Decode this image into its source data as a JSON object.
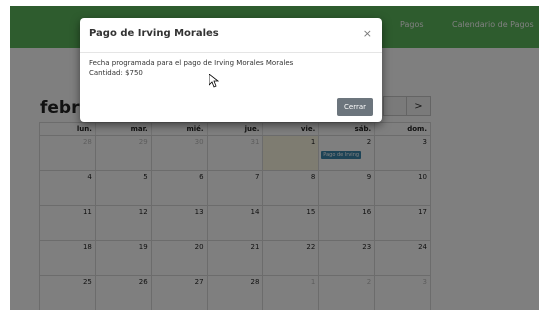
{
  "navbar": {
    "links": [
      "Pagos",
      "Calendario de Pagos"
    ]
  },
  "calendar": {
    "month_label": "febrero 2019",
    "prev_icon": "chevron-left-icon",
    "next_icon": "chevron-right-icon",
    "next_symbol": ">",
    "weekdays": [
      "lun.",
      "mar.",
      "mié.",
      "jue.",
      "vie.",
      "sáb.",
      "dom."
    ],
    "weeks": [
      [
        {
          "n": "28",
          "other": true
        },
        {
          "n": "29",
          "other": true
        },
        {
          "n": "30",
          "other": true
        },
        {
          "n": "31",
          "other": true
        },
        {
          "n": "1",
          "today": true
        },
        {
          "n": "2",
          "event": "Pago de Irving"
        },
        {
          "n": "3"
        }
      ],
      [
        {
          "n": "4"
        },
        {
          "n": "5"
        },
        {
          "n": "6"
        },
        {
          "n": "7"
        },
        {
          "n": "8"
        },
        {
          "n": "9"
        },
        {
          "n": "10"
        }
      ],
      [
        {
          "n": "11"
        },
        {
          "n": "12"
        },
        {
          "n": "13"
        },
        {
          "n": "14"
        },
        {
          "n": "15"
        },
        {
          "n": "16"
        },
        {
          "n": "17"
        }
      ],
      [
        {
          "n": "18"
        },
        {
          "n": "19"
        },
        {
          "n": "20"
        },
        {
          "n": "21"
        },
        {
          "n": "22"
        },
        {
          "n": "23"
        },
        {
          "n": "24"
        }
      ],
      [
        {
          "n": "25"
        },
        {
          "n": "26"
        },
        {
          "n": "27"
        },
        {
          "n": "28"
        },
        {
          "n": "1",
          "other": true
        },
        {
          "n": "2",
          "other": true
        },
        {
          "n": "3",
          "other": true
        }
      ]
    ]
  },
  "modal": {
    "title": "Pago de Irving Morales",
    "close_symbol": "×",
    "body_line1": "Fecha programada para el pago de Irving Morales Morales",
    "body_line2": "Cantidad: $750",
    "close_button": "Cerrar"
  },
  "colors": {
    "navbar": "#5cb85c",
    "event": "#3a87ad",
    "today": "#fcf8e3",
    "close_button": "#6c757d"
  }
}
